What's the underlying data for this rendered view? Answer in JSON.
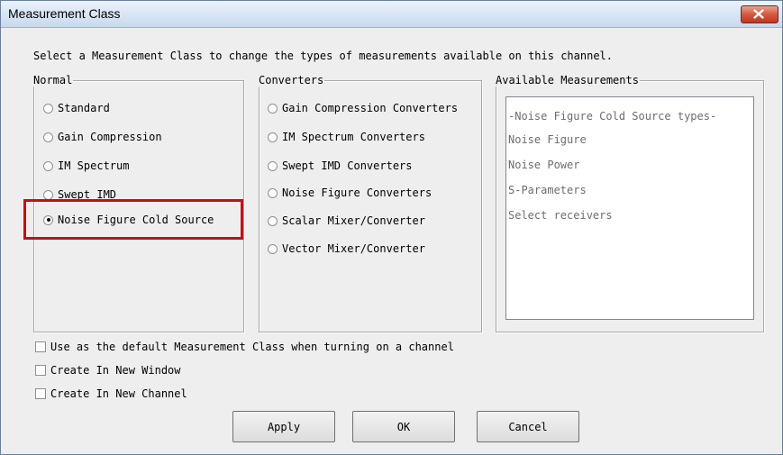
{
  "window": {
    "title": "Measurement Class",
    "close_label": "x"
  },
  "instruction": "Select a Measurement Class to change the types of measurements available on this channel.",
  "normal": {
    "label": "Normal",
    "options": [
      "Standard",
      "Gain Compression",
      "IM Spectrum",
      "Swept IMD",
      "Noise Figure Cold Source"
    ],
    "selected": "Noise Figure Cold Source"
  },
  "converters": {
    "label": "Converters",
    "options": [
      "Gain Compression Converters",
      "IM Spectrum Converters",
      "Swept IMD Converters",
      "Noise Figure Converters",
      "Scalar Mixer/Converter",
      "Vector Mixer/Converter"
    ]
  },
  "available": {
    "label": "Available Measurements",
    "items": [
      "-Noise Figure Cold Source types-",
      "Noise Figure",
      "Noise Power",
      "S-Parameters",
      "Select receivers"
    ]
  },
  "checkboxes": {
    "default_class": "Use as the default Measurement Class when turning on a channel",
    "new_window": "Create In New Window",
    "new_channel": "Create In New Channel"
  },
  "buttons": {
    "apply": "Apply",
    "ok": "OK",
    "cancel": "Cancel"
  },
  "colors": {
    "highlight": "#c0101a",
    "close_button": "#d4593e"
  }
}
